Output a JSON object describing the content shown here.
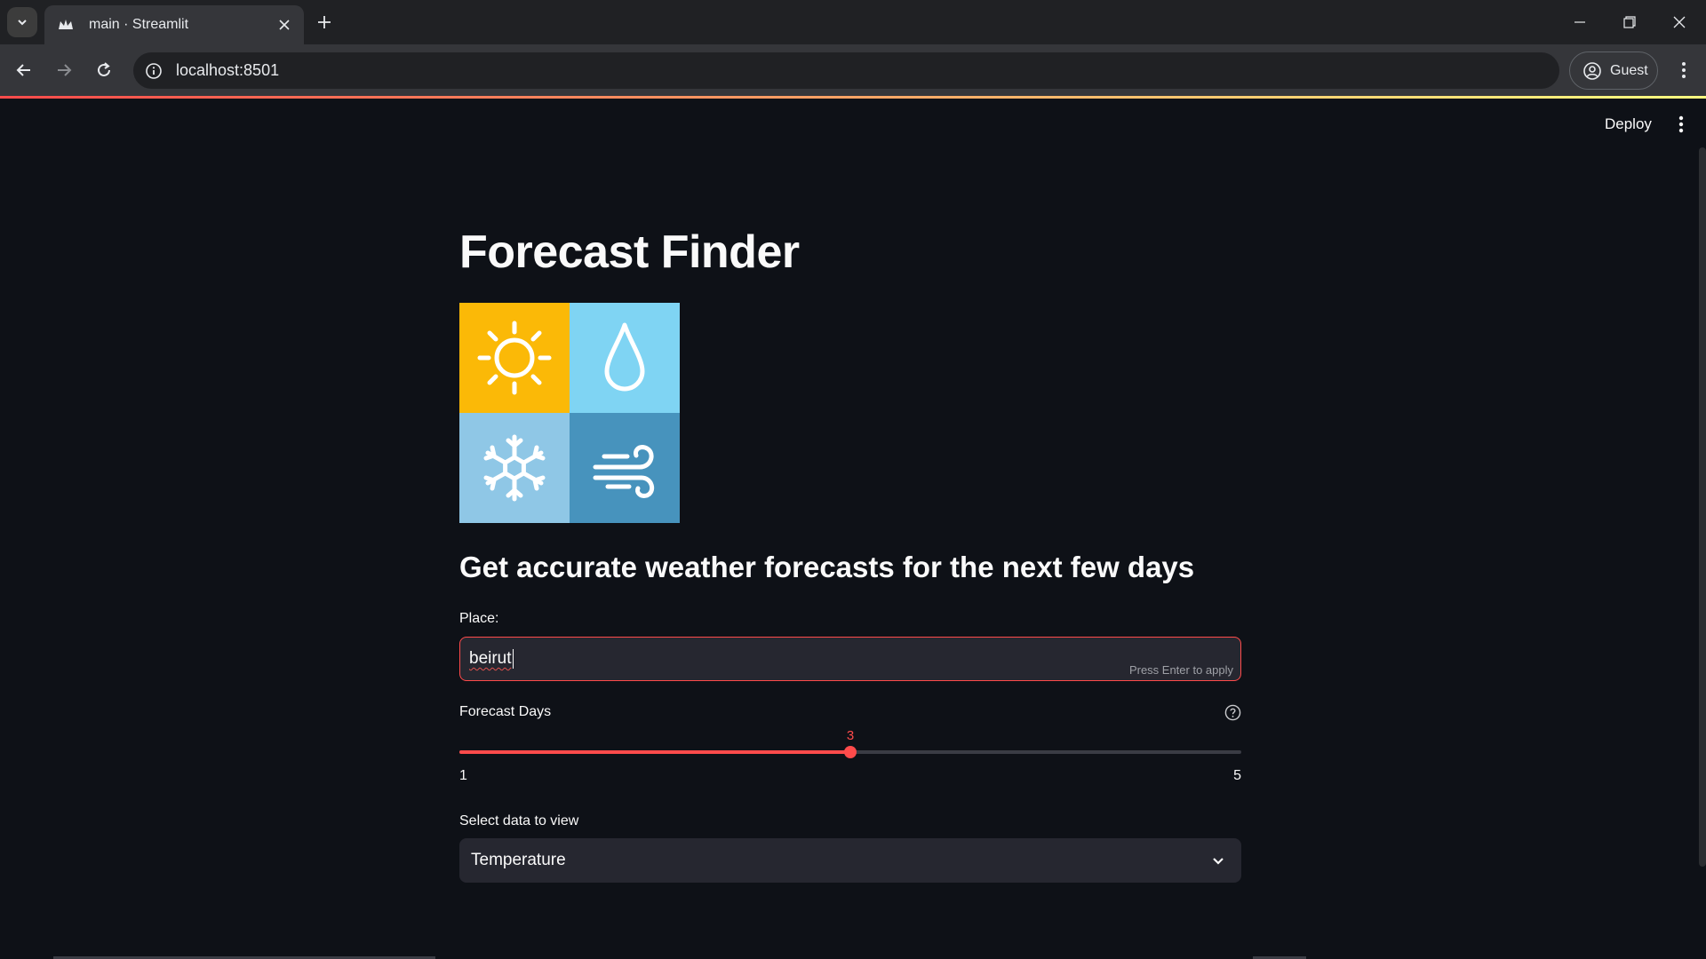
{
  "browser": {
    "tab_title": "main · Streamlit",
    "url": "localhost:8501",
    "profile_label": "Guest"
  },
  "header": {
    "deploy_label": "Deploy"
  },
  "main": {
    "title": "Forecast Finder",
    "subheader": "Get accurate weather forecasts for the next few days",
    "place": {
      "label": "Place:",
      "value": "beirut",
      "hint": "Press Enter to apply"
    },
    "forecast_days": {
      "label": "Forecast Days",
      "min": "1",
      "max": "5",
      "value": "3",
      "value_number": 3,
      "min_number": 1,
      "max_number": 5
    },
    "select_data": {
      "label": "Select data to view",
      "value": "Temperature"
    },
    "image_icons": [
      "sun-icon",
      "raindrop-icon",
      "snowflake-icon",
      "wind-icon"
    ]
  },
  "colors": {
    "accent": "#ff4b4b",
    "background": "#0e1117",
    "widget_bg": "#262730",
    "sun_tile": "#fbb907",
    "drop_tile": "#7fd4f3",
    "snow_tile": "#8fc7e6",
    "wind_tile": "#4793bd"
  }
}
